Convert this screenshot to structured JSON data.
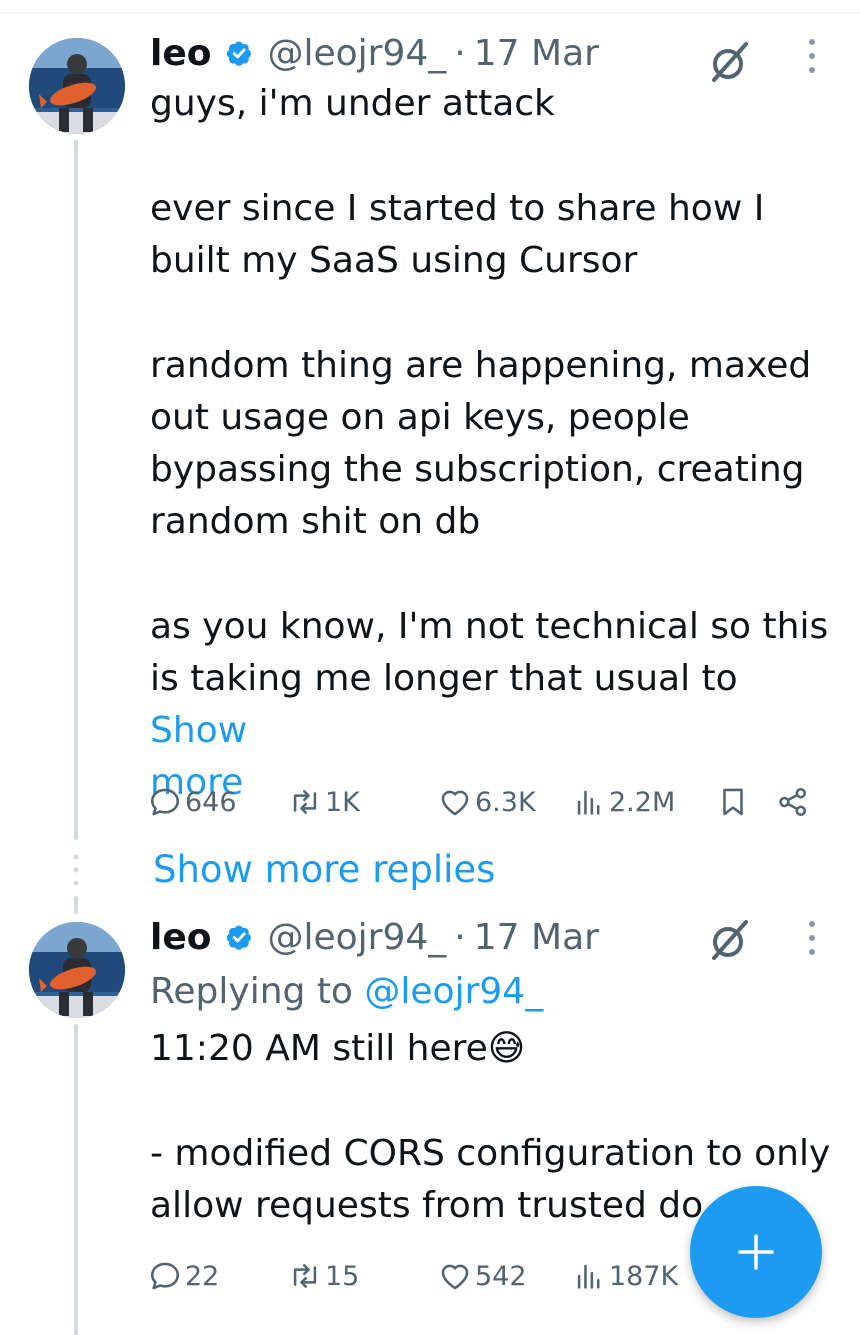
{
  "colors": {
    "accent": "#1d9bf0",
    "secondary_text": "#536471",
    "thread_line": "#cfd9de"
  },
  "tweets": [
    {
      "name": "leo",
      "handle": "@leojr94_",
      "sep": "·",
      "date": "17 Mar",
      "paragraphs": [
        "guys, i'm under attack",
        "ever since I started to share how I\nbuilt my SaaS using Cursor",
        "random thing are happening, maxed\nout usage on api keys, people\nbypassing the subscription, creating\nrandom shit on db"
      ],
      "last_paragraph": "as you know, I'm not technical so this\nis taking me longer that usual to ",
      "show_more": "Show\nmore",
      "stats": {
        "replies": "646",
        "reposts": "1K",
        "likes": "6.3K",
        "views": "2.2M"
      }
    },
    {
      "name": "leo",
      "handle": "@leojr94_",
      "sep": "·",
      "date": "17 Mar",
      "replying_label": "Replying to ",
      "replying_handle": "@leojr94_",
      "line1": "11:20 AM still here",
      "emoji": "😅",
      "paragraph2": "- modified CORS configuration to only\nallow requests from trusted do",
      "stats": {
        "replies": "22",
        "reposts": "15",
        "likes": "542",
        "views": "187K"
      }
    }
  ],
  "show_more_replies": "Show more replies",
  "icons": {
    "verified": "verified-badge-icon",
    "grok": "grok-icon",
    "more": "more-options-icon",
    "reply": "reply-icon",
    "repost": "repost-icon",
    "like": "like-icon",
    "views": "views-icon",
    "bookmark": "bookmark-icon",
    "share": "share-icon",
    "compose": "compose-plus-icon"
  }
}
